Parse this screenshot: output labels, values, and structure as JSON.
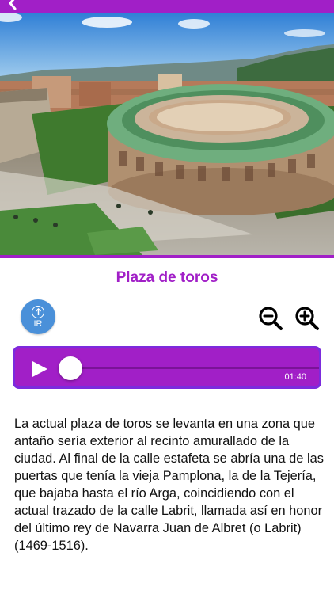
{
  "header": {
    "back_icon": "chevron-left-icon",
    "color": "#a11fc7"
  },
  "hero": {
    "image": "aerial photo of Pamplona bullring"
  },
  "title": "Plaza de toros",
  "actions": {
    "go_label": "IR",
    "go_icon": "arrow-up-circle-icon",
    "zoom_out_icon": "zoom-out-icon",
    "zoom_in_icon": "zoom-in-icon"
  },
  "player": {
    "time": "01:40",
    "progress": 0.0,
    "accent": "#a11fc7",
    "border": "#7c2bdd"
  },
  "description": "La actual plaza de toros se levanta en una zona que antaño sería exterior al recinto amurallado de la ciudad. Al final de la calle estafeta se abría una de las puertas que tenía la vieja Pamplona, la de la Tejería, que bajaba hasta el río Arga, coincidiendo con el actual trazado de la calle Labrit, llamada así en honor del último rey de Navarra Juan de Albret (o Labrit) (1469-1516)."
}
